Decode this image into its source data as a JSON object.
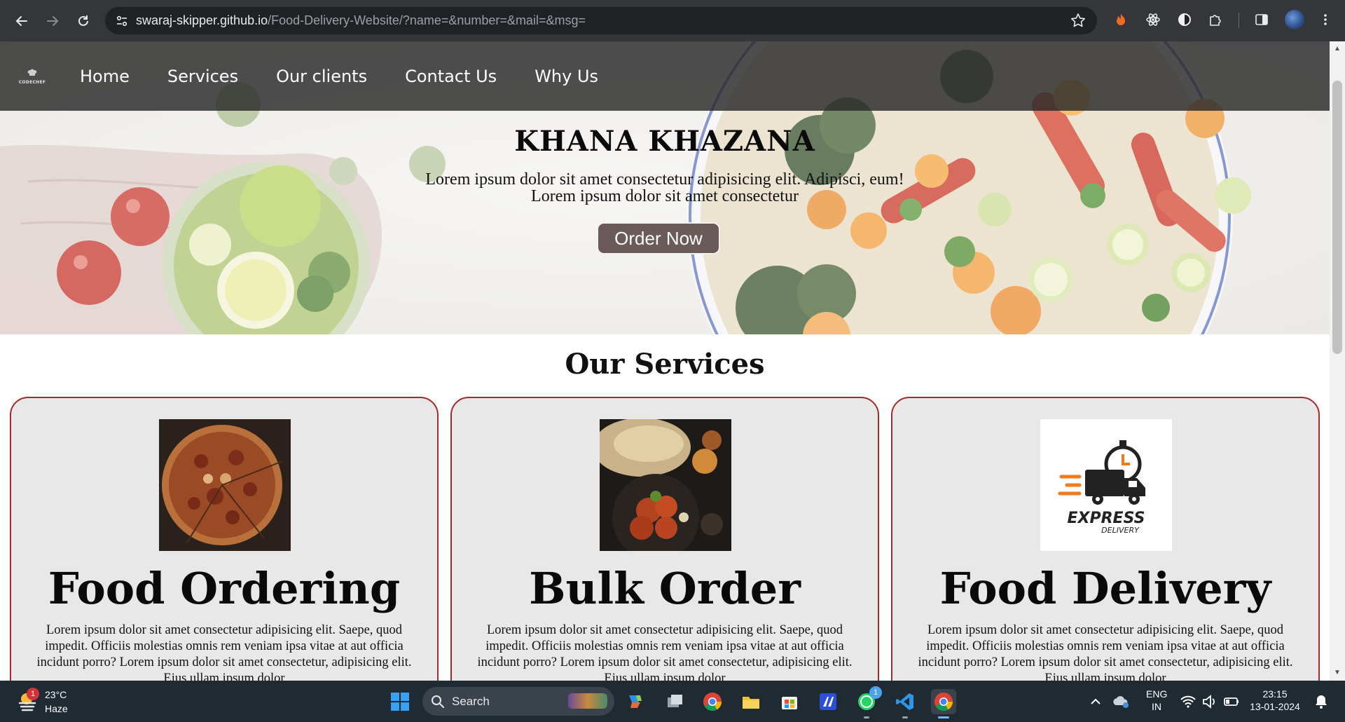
{
  "browser": {
    "url_host": "swaraj-skipper.github.io",
    "url_path": "/Food-Delivery-Website/?name=&number=&mail=&msg="
  },
  "site": {
    "logo_text": "CODECHEF",
    "nav": [
      "Home",
      "Services",
      "Our clients",
      "Contact Us",
      "Why Us"
    ],
    "hero_title": "KHANA KHAZANA",
    "hero_line1": "Lorem ipsum dolor sit amet consectetur adipisicing elit. Adipisci, eum!",
    "hero_line2": "Lorem ipsum dolor sit amet consectetur",
    "order_button": "Order Now",
    "services_title": "Our Services",
    "cards": [
      {
        "title": "Food Ordering",
        "text": "Lorem ipsum dolor sit amet consectetur adipisicing elit. Saepe, quod impedit. Officiis molestias omnis rem veniam ipsa vitae at aut officia incidunt porro? Lorem ipsum dolor sit amet consectetur, adipisicing elit. Eius ullam ipsum dolor"
      },
      {
        "title": "Bulk Order",
        "text": "Lorem ipsum dolor sit amet consectetur adipisicing elit. Saepe, quod impedit. Officiis molestias omnis rem veniam ipsa vitae at aut officia incidunt porro? Lorem ipsum dolor sit amet consectetur, adipisicing elit. Eius ullam ipsum dolor"
      },
      {
        "title": "Food Delivery",
        "text": "Lorem ipsum dolor sit amet consectetur adipisicing elit. Saepe, quod impedit. Officiis molestias omnis rem veniam ipsa vitae at aut officia incidunt porro? Lorem ipsum dolor sit amet consectetur, adipisicing elit. Eius ullam ipsum dolor"
      }
    ],
    "express_logo_main": "EXPRESS",
    "express_logo_sub": "DELIVERY"
  },
  "taskbar": {
    "weather_badge": "1",
    "weather_temp": "23°C",
    "weather_condition": "Haze",
    "search_label": "Search",
    "whatsapp_badge": "1",
    "lang_top": "ENG",
    "lang_bottom": "IN",
    "time": "23:15",
    "date": "13-01-2024"
  },
  "colors": {
    "card_border": "#a52a2a",
    "card_bg": "#e8e8e8",
    "navbar_bg": "#282828",
    "order_button_bg": "#6b5a5a"
  }
}
